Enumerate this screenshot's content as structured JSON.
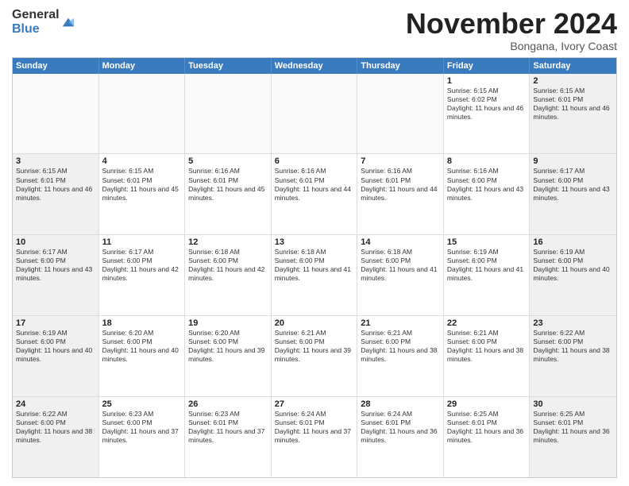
{
  "logo": {
    "general": "General",
    "blue": "Blue"
  },
  "header": {
    "month": "November 2024",
    "location": "Bongana, Ivory Coast"
  },
  "weekdays": [
    "Sunday",
    "Monday",
    "Tuesday",
    "Wednesday",
    "Thursday",
    "Friday",
    "Saturday"
  ],
  "rows": [
    [
      {
        "day": "",
        "empty": true
      },
      {
        "day": "",
        "empty": true
      },
      {
        "day": "",
        "empty": true
      },
      {
        "day": "",
        "empty": true
      },
      {
        "day": "",
        "empty": true
      },
      {
        "day": "1",
        "rise": "Sunrise: 6:15 AM",
        "set": "Sunset: 6:02 PM",
        "daylight": "Daylight: 11 hours and 46 minutes."
      },
      {
        "day": "2",
        "rise": "Sunrise: 6:15 AM",
        "set": "Sunset: 6:01 PM",
        "daylight": "Daylight: 11 hours and 46 minutes."
      }
    ],
    [
      {
        "day": "3",
        "rise": "Sunrise: 6:15 AM",
        "set": "Sunset: 6:01 PM",
        "daylight": "Daylight: 11 hours and 46 minutes."
      },
      {
        "day": "4",
        "rise": "Sunrise: 6:15 AM",
        "set": "Sunset: 6:01 PM",
        "daylight": "Daylight: 11 hours and 45 minutes."
      },
      {
        "day": "5",
        "rise": "Sunrise: 6:16 AM",
        "set": "Sunset: 6:01 PM",
        "daylight": "Daylight: 11 hours and 45 minutes."
      },
      {
        "day": "6",
        "rise": "Sunrise: 6:16 AM",
        "set": "Sunset: 6:01 PM",
        "daylight": "Daylight: 11 hours and 44 minutes."
      },
      {
        "day": "7",
        "rise": "Sunrise: 6:16 AM",
        "set": "Sunset: 6:01 PM",
        "daylight": "Daylight: 11 hours and 44 minutes."
      },
      {
        "day": "8",
        "rise": "Sunrise: 6:16 AM",
        "set": "Sunset: 6:00 PM",
        "daylight": "Daylight: 11 hours and 43 minutes."
      },
      {
        "day": "9",
        "rise": "Sunrise: 6:17 AM",
        "set": "Sunset: 6:00 PM",
        "daylight": "Daylight: 11 hours and 43 minutes."
      }
    ],
    [
      {
        "day": "10",
        "rise": "Sunrise: 6:17 AM",
        "set": "Sunset: 6:00 PM",
        "daylight": "Daylight: 11 hours and 43 minutes."
      },
      {
        "day": "11",
        "rise": "Sunrise: 6:17 AM",
        "set": "Sunset: 6:00 PM",
        "daylight": "Daylight: 11 hours and 42 minutes."
      },
      {
        "day": "12",
        "rise": "Sunrise: 6:18 AM",
        "set": "Sunset: 6:00 PM",
        "daylight": "Daylight: 11 hours and 42 minutes."
      },
      {
        "day": "13",
        "rise": "Sunrise: 6:18 AM",
        "set": "Sunset: 6:00 PM",
        "daylight": "Daylight: 11 hours and 41 minutes."
      },
      {
        "day": "14",
        "rise": "Sunrise: 6:18 AM",
        "set": "Sunset: 6:00 PM",
        "daylight": "Daylight: 11 hours and 41 minutes."
      },
      {
        "day": "15",
        "rise": "Sunrise: 6:19 AM",
        "set": "Sunset: 6:00 PM",
        "daylight": "Daylight: 11 hours and 41 minutes."
      },
      {
        "day": "16",
        "rise": "Sunrise: 6:19 AM",
        "set": "Sunset: 6:00 PM",
        "daylight": "Daylight: 11 hours and 40 minutes."
      }
    ],
    [
      {
        "day": "17",
        "rise": "Sunrise: 6:19 AM",
        "set": "Sunset: 6:00 PM",
        "daylight": "Daylight: 11 hours and 40 minutes."
      },
      {
        "day": "18",
        "rise": "Sunrise: 6:20 AM",
        "set": "Sunset: 6:00 PM",
        "daylight": "Daylight: 11 hours and 40 minutes."
      },
      {
        "day": "19",
        "rise": "Sunrise: 6:20 AM",
        "set": "Sunset: 6:00 PM",
        "daylight": "Daylight: 11 hours and 39 minutes."
      },
      {
        "day": "20",
        "rise": "Sunrise: 6:21 AM",
        "set": "Sunset: 6:00 PM",
        "daylight": "Daylight: 11 hours and 39 minutes."
      },
      {
        "day": "21",
        "rise": "Sunrise: 6:21 AM",
        "set": "Sunset: 6:00 PM",
        "daylight": "Daylight: 11 hours and 38 minutes."
      },
      {
        "day": "22",
        "rise": "Sunrise: 6:21 AM",
        "set": "Sunset: 6:00 PM",
        "daylight": "Daylight: 11 hours and 38 minutes."
      },
      {
        "day": "23",
        "rise": "Sunrise: 6:22 AM",
        "set": "Sunset: 6:00 PM",
        "daylight": "Daylight: 11 hours and 38 minutes."
      }
    ],
    [
      {
        "day": "24",
        "rise": "Sunrise: 6:22 AM",
        "set": "Sunset: 6:00 PM",
        "daylight": "Daylight: 11 hours and 38 minutes."
      },
      {
        "day": "25",
        "rise": "Sunrise: 6:23 AM",
        "set": "Sunset: 6:00 PM",
        "daylight": "Daylight: 11 hours and 37 minutes."
      },
      {
        "day": "26",
        "rise": "Sunrise: 6:23 AM",
        "set": "Sunset: 6:01 PM",
        "daylight": "Daylight: 11 hours and 37 minutes."
      },
      {
        "day": "27",
        "rise": "Sunrise: 6:24 AM",
        "set": "Sunset: 6:01 PM",
        "daylight": "Daylight: 11 hours and 37 minutes."
      },
      {
        "day": "28",
        "rise": "Sunrise: 6:24 AM",
        "set": "Sunset: 6:01 PM",
        "daylight": "Daylight: 11 hours and 36 minutes."
      },
      {
        "day": "29",
        "rise": "Sunrise: 6:25 AM",
        "set": "Sunset: 6:01 PM",
        "daylight": "Daylight: 11 hours and 36 minutes."
      },
      {
        "day": "30",
        "rise": "Sunrise: 6:25 AM",
        "set": "Sunset: 6:01 PM",
        "daylight": "Daylight: 11 hours and 36 minutes."
      }
    ]
  ]
}
